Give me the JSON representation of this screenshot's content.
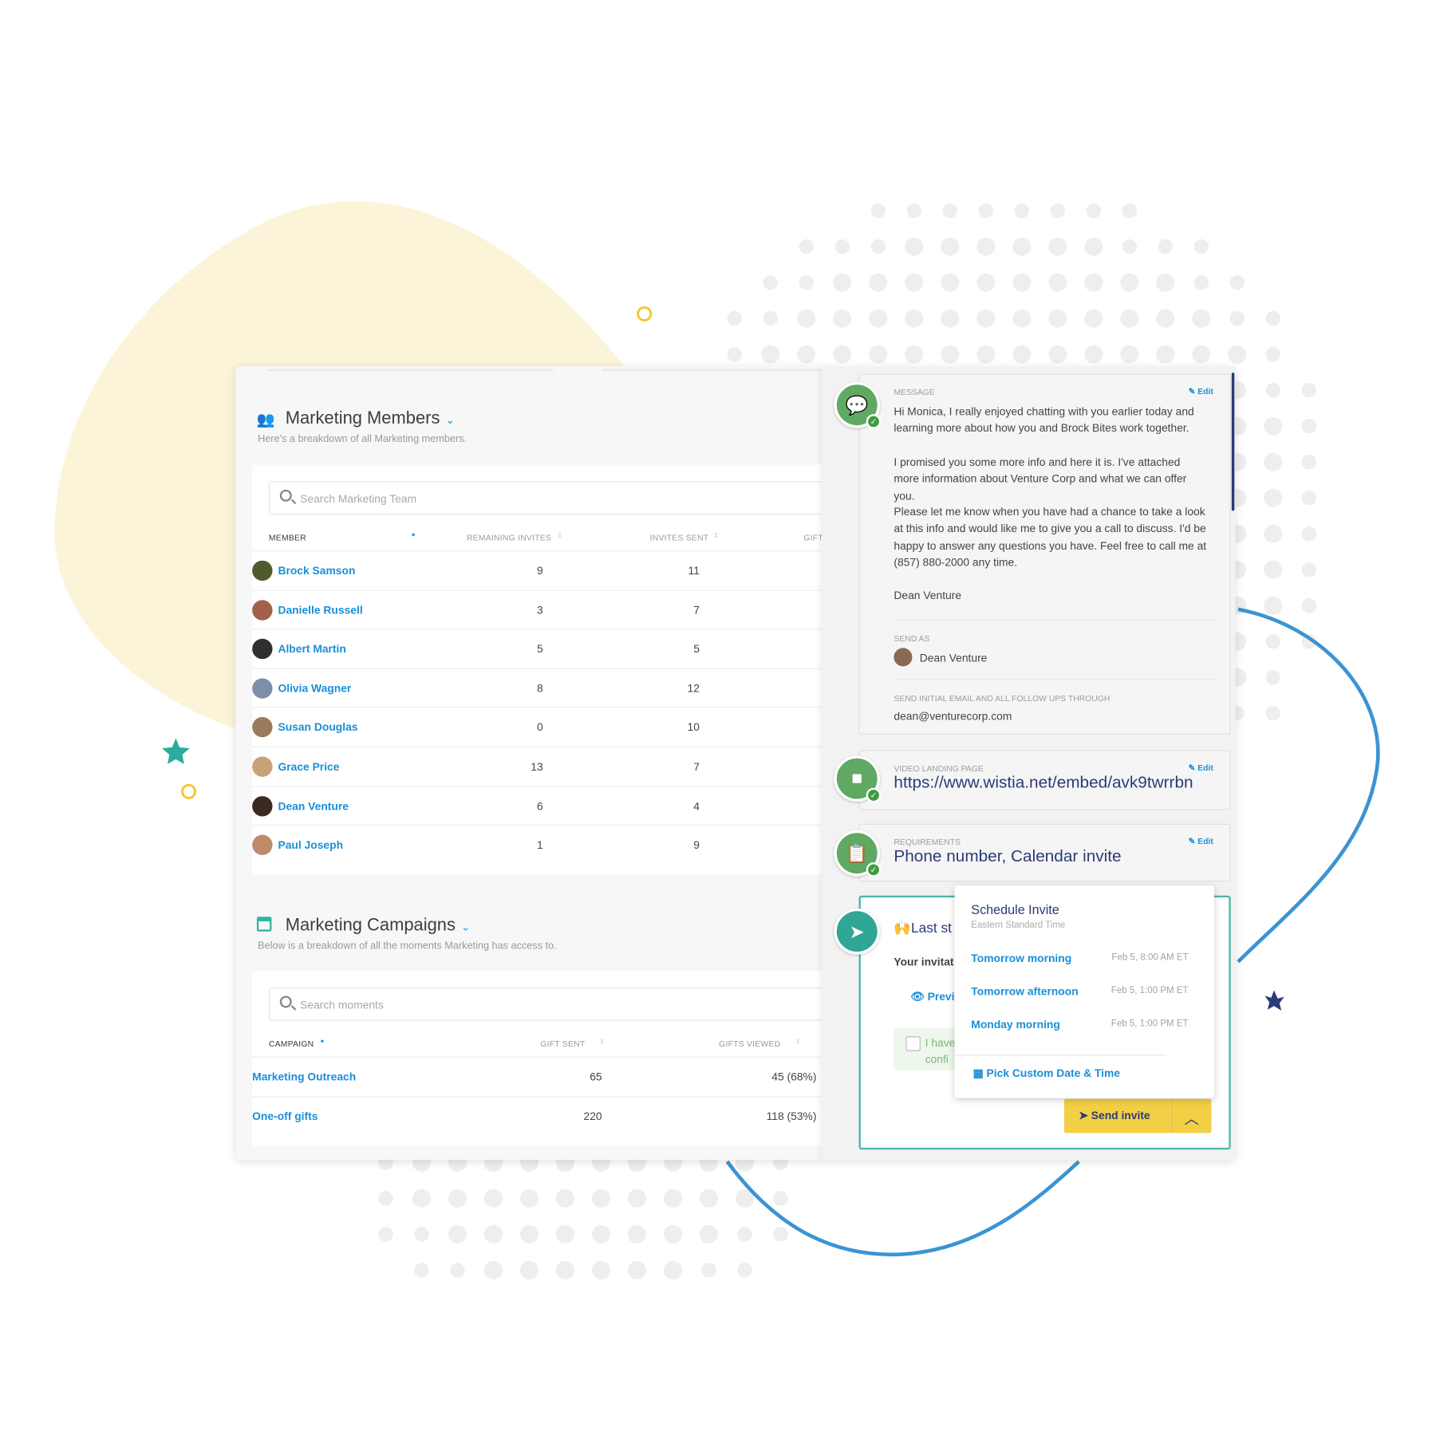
{
  "colors": {
    "accent": "#1a8fd6",
    "teal": "#2fb3a6",
    "green": "#5fa962",
    "yellow": "#f2cf45",
    "navy": "#2b3a78",
    "blob": "#fbf4d8",
    "curve": "#3a94d4"
  },
  "members": {
    "title": "Marketing Members",
    "subtitle": "Here's a breakdown of all Marketing members.",
    "search_placeholder": "Search Marketing Team",
    "columns": [
      "Member",
      "Remaining Invites",
      "Invites Sent",
      "Gift"
    ],
    "rows": [
      {
        "name": "Brock Samson",
        "remaining": "9",
        "sent": "11"
      },
      {
        "name": "Danielle Russell",
        "remaining": "3",
        "sent": "7"
      },
      {
        "name": "Albert Martin",
        "remaining": "5",
        "sent": "5"
      },
      {
        "name": "Olivia Wagner",
        "remaining": "8",
        "sent": "12"
      },
      {
        "name": "Susan Douglas",
        "remaining": "0",
        "sent": "10"
      },
      {
        "name": "Grace Price",
        "remaining": "13",
        "sent": "7"
      },
      {
        "name": "Dean Venture",
        "remaining": "6",
        "sent": "4"
      },
      {
        "name": "Paul Joseph",
        "remaining": "1",
        "sent": "9"
      }
    ]
  },
  "campaigns": {
    "title": "Marketing Campaigns",
    "subtitle": "Below is a breakdown of all the moments Marketing has access to.",
    "search_placeholder": "Search moments",
    "columns": [
      "Campaign",
      "Gift Sent",
      "Gifts Viewed"
    ],
    "rows": [
      {
        "name": "Marketing Outreach",
        "sent": "65",
        "viewed": "45 (68%)"
      },
      {
        "name": "One-off gifts",
        "sent": "220",
        "viewed": "118 (53%)"
      }
    ]
  },
  "message": {
    "label": "Message",
    "edit": "Edit",
    "p1": "Hi Monica, I really enjoyed chatting with you earlier today and learning more about how you and Brock Bites work together.",
    "p2": "I promised you some more info and here it is. I've attached more information about Venture Corp and what we can offer you.",
    "p3": "Please let me know when you have had a chance to take a look at this info and would like me to give you a call to discuss. I'd be happy to answer any questions you have. Feel free to call me at (857) 880-2000 any time.",
    "signature": "Dean Venture",
    "send_as_label": "Send as",
    "send_as": "Dean Venture",
    "through_label": "Send initial email and all follow ups through",
    "through": "dean@venturecorp.com"
  },
  "video": {
    "label": "Video landing page",
    "edit": "Edit",
    "url": "https://www.wistia.net/embed/avk9twrrbn"
  },
  "requirements": {
    "label": "Requirements",
    "edit": "Edit",
    "value": "Phone number, Calendar invite"
  },
  "last_step": {
    "emoji": "🙌",
    "title": "Last st",
    "invitation": "Your invitat",
    "preview": "Previ",
    "confirm1": "I have",
    "confirm2": "confi"
  },
  "schedule": {
    "title": "Schedule Invite",
    "timezone": "Eastern Standard Time",
    "options": [
      {
        "label": "Tomorrow morning",
        "date": "Feb 5, 8:00 AM ET"
      },
      {
        "label": "Tomorrow afternoon",
        "date": "Feb 5, 1:00 PM ET"
      },
      {
        "label": "Monday morning",
        "date": "Feb 5, 1:00 PM ET"
      }
    ],
    "custom": "Pick Custom Date & Time"
  },
  "send_button": "Send invite"
}
